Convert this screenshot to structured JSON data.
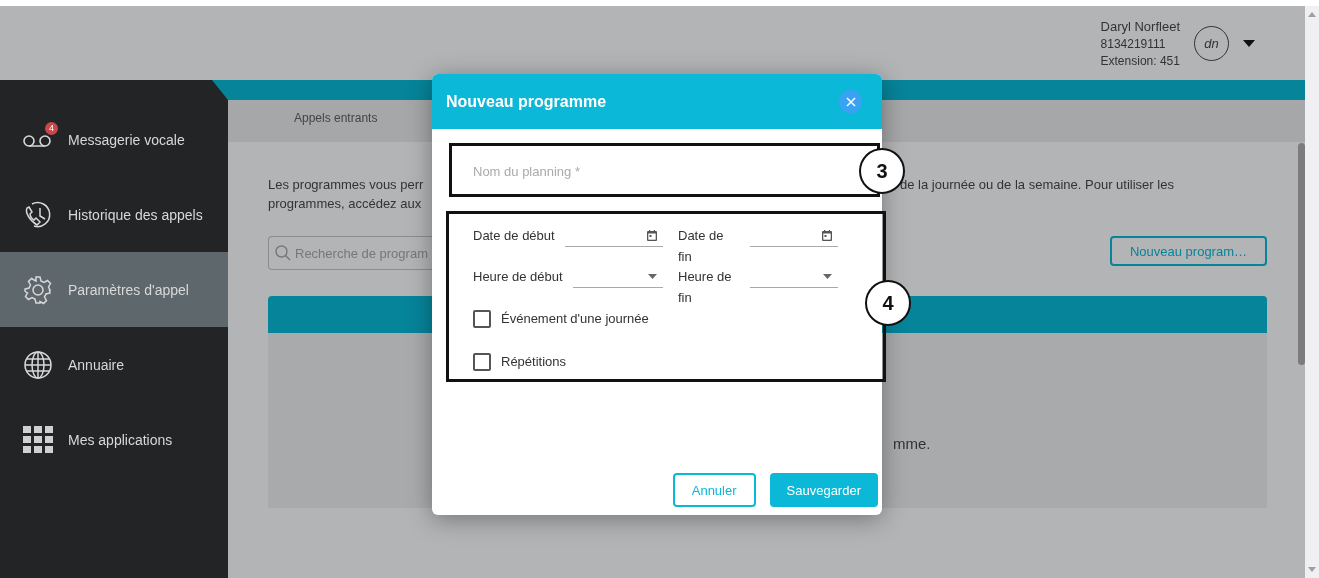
{
  "header": {
    "user_name": "Daryl Norfleet",
    "phone": "8134219111",
    "extension": "Extension: 451",
    "avatar_initials": "dn"
  },
  "sidebar": {
    "items": [
      {
        "label": "Messagerie vocale",
        "kind": "voicemail",
        "badge": "4",
        "selected": false
      },
      {
        "label": "Historique des appels",
        "kind": "history",
        "selected": false
      },
      {
        "label": "Paramètres d'appel",
        "kind": "settings",
        "selected": true
      },
      {
        "label": "Annuaire",
        "kind": "directory",
        "selected": false
      },
      {
        "label": "Mes applications",
        "kind": "apps",
        "selected": false
      }
    ]
  },
  "tabs": [
    {
      "label": "Appels entrants",
      "selected": false
    }
  ],
  "intro": {
    "line_1_start": "Les programmes vous perr",
    "line_1_end": "de la journée ou de la semaine. Pour utiliser les",
    "line_2_start": "programmes, accédez aux"
  },
  "search": {
    "placeholder": "Recherche de program"
  },
  "new_button": "Nouveau program…",
  "table": {
    "empty_text_end": "mme."
  },
  "dialog": {
    "title": "Nouveau programme",
    "name_field": {
      "placeholder": "Nom du planning *"
    },
    "fields": [
      {
        "label": "Date de début",
        "kind": "date"
      },
      {
        "label": "Date de fin",
        "kind": "date"
      },
      {
        "label": "Heure de début",
        "kind": "select"
      },
      {
        "label": "Heure de fin",
        "kind": "select"
      }
    ],
    "checkboxes": [
      {
        "label": "Événement d'une journée",
        "checked": false
      },
      {
        "label": "Répétitions",
        "checked": false
      }
    ],
    "buttons": [
      {
        "label": "Annuler",
        "kind": "secondary"
      },
      {
        "label": "Sauvegarder",
        "kind": "primary"
      }
    ],
    "callouts": [
      "3",
      "4"
    ]
  }
}
